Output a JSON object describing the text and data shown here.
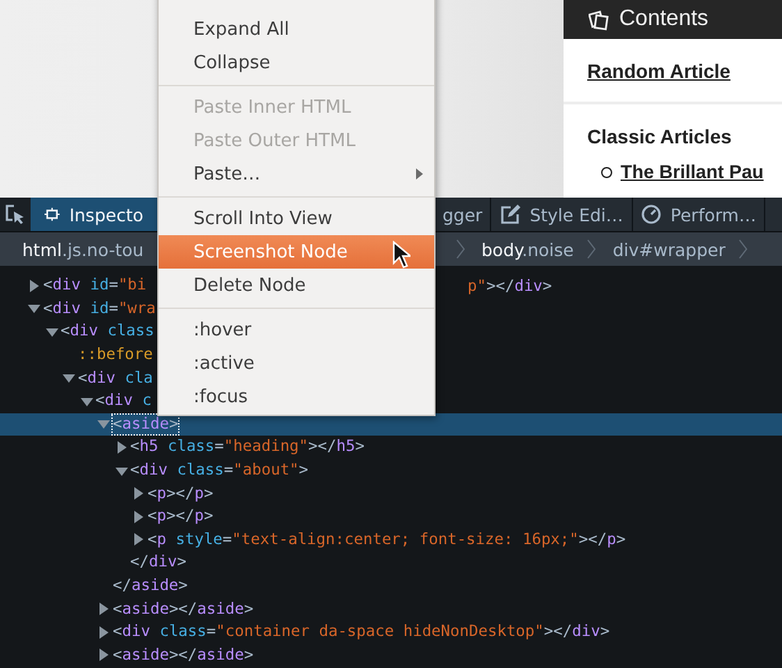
{
  "sidebar": {
    "title": "Contents",
    "featured_link": "Random Article",
    "section_title": "Classic Articles",
    "articles": [
      "The Brillant Pau"
    ]
  },
  "toolbar": {
    "tabs": [
      {
        "kind": "inspector",
        "label": "Inspecto",
        "selected": true
      },
      {
        "kind": "debugger",
        "label": "gger",
        "selected": false
      },
      {
        "kind": "style-editor",
        "label": "Style Edi…",
        "selected": false
      },
      {
        "kind": "performance",
        "label": "Perform…",
        "selected": false
      }
    ]
  },
  "breadcrumbs": [
    "**html**.js.no-tou",
    "**body**.noise",
    "div#wrapper"
  ],
  "markup": [
    {
      "expandable": true,
      "expanded": false,
      "selected": false,
      "tokens": [
        {
          "kind": "punct",
          "text": "<"
        },
        {
          "kind": "tag",
          "text": "div"
        },
        {
          "kind": "attr",
          "text": " id"
        },
        {
          "kind": "punct",
          "text": "="
        },
        {
          "kind": "value",
          "text": "\"bi"
        }
      ],
      "after": [
        {
          "kind": "value",
          "text": "p\""
        },
        {
          "kind": "punct",
          "text": "></"
        },
        {
          "kind": "tag",
          "text": "div"
        },
        {
          "kind": "punct",
          "text": ">"
        }
      ]
    },
    {
      "expandable": true,
      "expanded": true,
      "selected": false,
      "tokens": [
        {
          "kind": "punct",
          "text": "<"
        },
        {
          "kind": "tag",
          "text": "div"
        },
        {
          "kind": "attr",
          "text": " id"
        },
        {
          "kind": "punct",
          "text": "="
        },
        {
          "kind": "value",
          "text": "\"wra"
        }
      ],
      "children": [
        {
          "expandable": true,
          "expanded": true,
          "selected": false,
          "tokens": [
            {
              "kind": "punct",
              "text": "<"
            },
            {
              "kind": "tag",
              "text": "div"
            },
            {
              "kind": "attr",
              "text": " class"
            }
          ],
          "children": [
            {
              "expandable": false,
              "selected": false,
              "tokens": [
                {
                  "kind": "pseudo",
                  "text": "::before"
                }
              ]
            },
            {
              "expandable": true,
              "expanded": true,
              "selected": false,
              "tokens": [
                {
                  "kind": "punct",
                  "text": "<"
                },
                {
                  "kind": "tag",
                  "text": "div"
                },
                {
                  "kind": "attr",
                  "text": " cla"
                }
              ],
              "children": [
                {
                  "expandable": true,
                  "expanded": true,
                  "selected": false,
                  "tokens": [
                    {
                      "kind": "punct",
                      "text": "<"
                    },
                    {
                      "kind": "tag",
                      "text": "div"
                    },
                    {
                      "kind": "attr",
                      "text": " c"
                    }
                  ],
                  "children": [
                    {
                      "expandable": true,
                      "expanded": true,
                      "selected": true,
                      "tokens": [
                        {
                          "kind": "punct",
                          "text": "<"
                        },
                        {
                          "kind": "tag",
                          "text": "aside"
                        },
                        {
                          "kind": "punct",
                          "text": ">"
                        }
                      ],
                      "children": [
                        {
                          "expandable": true,
                          "expanded": false,
                          "selected": false,
                          "tokens": [
                            {
                              "kind": "punct",
                              "text": "<"
                            },
                            {
                              "kind": "tag",
                              "text": "h5"
                            },
                            {
                              "kind": "attr",
                              "text": " class"
                            },
                            {
                              "kind": "punct",
                              "text": "="
                            },
                            {
                              "kind": "value",
                              "text": "\"heading\""
                            },
                            {
                              "kind": "punct",
                              "text": "></"
                            },
                            {
                              "kind": "tag",
                              "text": "h5"
                            },
                            {
                              "kind": "punct",
                              "text": ">"
                            }
                          ]
                        },
                        {
                          "expandable": true,
                          "expanded": true,
                          "selected": false,
                          "tokens": [
                            {
                              "kind": "punct",
                              "text": "<"
                            },
                            {
                              "kind": "tag",
                              "text": "div"
                            },
                            {
                              "kind": "attr",
                              "text": " class"
                            },
                            {
                              "kind": "punct",
                              "text": "="
                            },
                            {
                              "kind": "value",
                              "text": "\"about\""
                            },
                            {
                              "kind": "punct",
                              "text": ">"
                            }
                          ],
                          "children": [
                            {
                              "expandable": true,
                              "expanded": false,
                              "selected": false,
                              "tokens": [
                                {
                                  "kind": "punct",
                                  "text": "<"
                                },
                                {
                                  "kind": "tag",
                                  "text": "p"
                                },
                                {
                                  "kind": "punct",
                                  "text": "></"
                                },
                                {
                                  "kind": "tag",
                                  "text": "p"
                                },
                                {
                                  "kind": "punct",
                                  "text": ">"
                                }
                              ]
                            },
                            {
                              "expandable": true,
                              "expanded": false,
                              "selected": false,
                              "tokens": [
                                {
                                  "kind": "punct",
                                  "text": "<"
                                },
                                {
                                  "kind": "tag",
                                  "text": "p"
                                },
                                {
                                  "kind": "punct",
                                  "text": "></"
                                },
                                {
                                  "kind": "tag",
                                  "text": "p"
                                },
                                {
                                  "kind": "punct",
                                  "text": ">"
                                }
                              ]
                            },
                            {
                              "expandable": true,
                              "expanded": false,
                              "selected": false,
                              "tokens": [
                                {
                                  "kind": "punct",
                                  "text": "<"
                                },
                                {
                                  "kind": "tag",
                                  "text": "p"
                                },
                                {
                                  "kind": "attr",
                                  "text": " style"
                                },
                                {
                                  "kind": "punct",
                                  "text": "="
                                },
                                {
                                  "kind": "value",
                                  "text": "\"text-align:center; font-size: 16px;\""
                                },
                                {
                                  "kind": "punct",
                                  "text": "></"
                                },
                                {
                                  "kind": "tag",
                                  "text": "p"
                                },
                                {
                                  "kind": "punct",
                                  "text": ">"
                                }
                              ]
                            }
                          ]
                        },
                        {
                          "expandable": false,
                          "selected": false,
                          "tokens": [
                            {
                              "kind": "punct",
                              "text": "</"
                            },
                            {
                              "kind": "tag",
                              "text": "div"
                            },
                            {
                              "kind": "punct",
                              "text": ">"
                            }
                          ]
                        }
                      ]
                    },
                    {
                      "expandable": false,
                      "selected": false,
                      "tokens": [
                        {
                          "kind": "punct",
                          "text": "</"
                        },
                        {
                          "kind": "tag",
                          "text": "aside"
                        },
                        {
                          "kind": "punct",
                          "text": ">"
                        }
                      ]
                    },
                    {
                      "expandable": true,
                      "expanded": false,
                      "selected": false,
                      "tokens": [
                        {
                          "kind": "punct",
                          "text": "<"
                        },
                        {
                          "kind": "tag",
                          "text": "aside"
                        },
                        {
                          "kind": "punct",
                          "text": "></"
                        },
                        {
                          "kind": "tag",
                          "text": "aside"
                        },
                        {
                          "kind": "punct",
                          "text": ">"
                        }
                      ]
                    },
                    {
                      "expandable": true,
                      "expanded": false,
                      "selected": false,
                      "tokens": [
                        {
                          "kind": "punct",
                          "text": "<"
                        },
                        {
                          "kind": "tag",
                          "text": "div"
                        },
                        {
                          "kind": "attr",
                          "text": " class"
                        },
                        {
                          "kind": "punct",
                          "text": "="
                        },
                        {
                          "kind": "value",
                          "text": "\"container da-space hideNonDesktop\""
                        },
                        {
                          "kind": "punct",
                          "text": "></"
                        },
                        {
                          "kind": "tag",
                          "text": "div"
                        },
                        {
                          "kind": "punct",
                          "text": ">"
                        }
                      ]
                    },
                    {
                      "expandable": true,
                      "expanded": false,
                      "selected": false,
                      "tokens": [
                        {
                          "kind": "punct",
                          "text": "<"
                        },
                        {
                          "kind": "tag",
                          "text": "aside"
                        },
                        {
                          "kind": "punct",
                          "text": "></"
                        },
                        {
                          "kind": "tag",
                          "text": "aside"
                        },
                        {
                          "kind": "punct",
                          "text": ">"
                        }
                      ]
                    }
                  ]
                }
              ]
            }
          ]
        }
      ]
    }
  ],
  "context_menu": {
    "items": [
      {
        "kind": "item",
        "label": "Expand All",
        "disabled": false,
        "highlighted": false,
        "submenu": false
      },
      {
        "kind": "item",
        "label": "Collapse",
        "disabled": false,
        "highlighted": false,
        "submenu": false
      },
      {
        "kind": "separator"
      },
      {
        "kind": "item",
        "label": "Paste Inner HTML",
        "disabled": true,
        "highlighted": false,
        "submenu": false
      },
      {
        "kind": "item",
        "label": "Paste Outer HTML",
        "disabled": true,
        "highlighted": false,
        "submenu": false
      },
      {
        "kind": "item",
        "label": "Paste…",
        "disabled": false,
        "highlighted": false,
        "submenu": true
      },
      {
        "kind": "separator"
      },
      {
        "kind": "item",
        "label": "Scroll Into View",
        "disabled": false,
        "highlighted": false,
        "submenu": false
      },
      {
        "kind": "item",
        "label": "Screenshot Node",
        "disabled": false,
        "highlighted": true,
        "submenu": false
      },
      {
        "kind": "item",
        "label": "Delete Node",
        "disabled": false,
        "highlighted": false,
        "submenu": false
      },
      {
        "kind": "separator"
      },
      {
        "kind": "item",
        "label": ":hover",
        "disabled": false,
        "highlighted": false,
        "submenu": false
      },
      {
        "kind": "item",
        "label": ":active",
        "disabled": false,
        "highlighted": false,
        "submenu": false
      },
      {
        "kind": "item",
        "label": ":focus",
        "disabled": false,
        "highlighted": false,
        "submenu": false
      }
    ]
  }
}
